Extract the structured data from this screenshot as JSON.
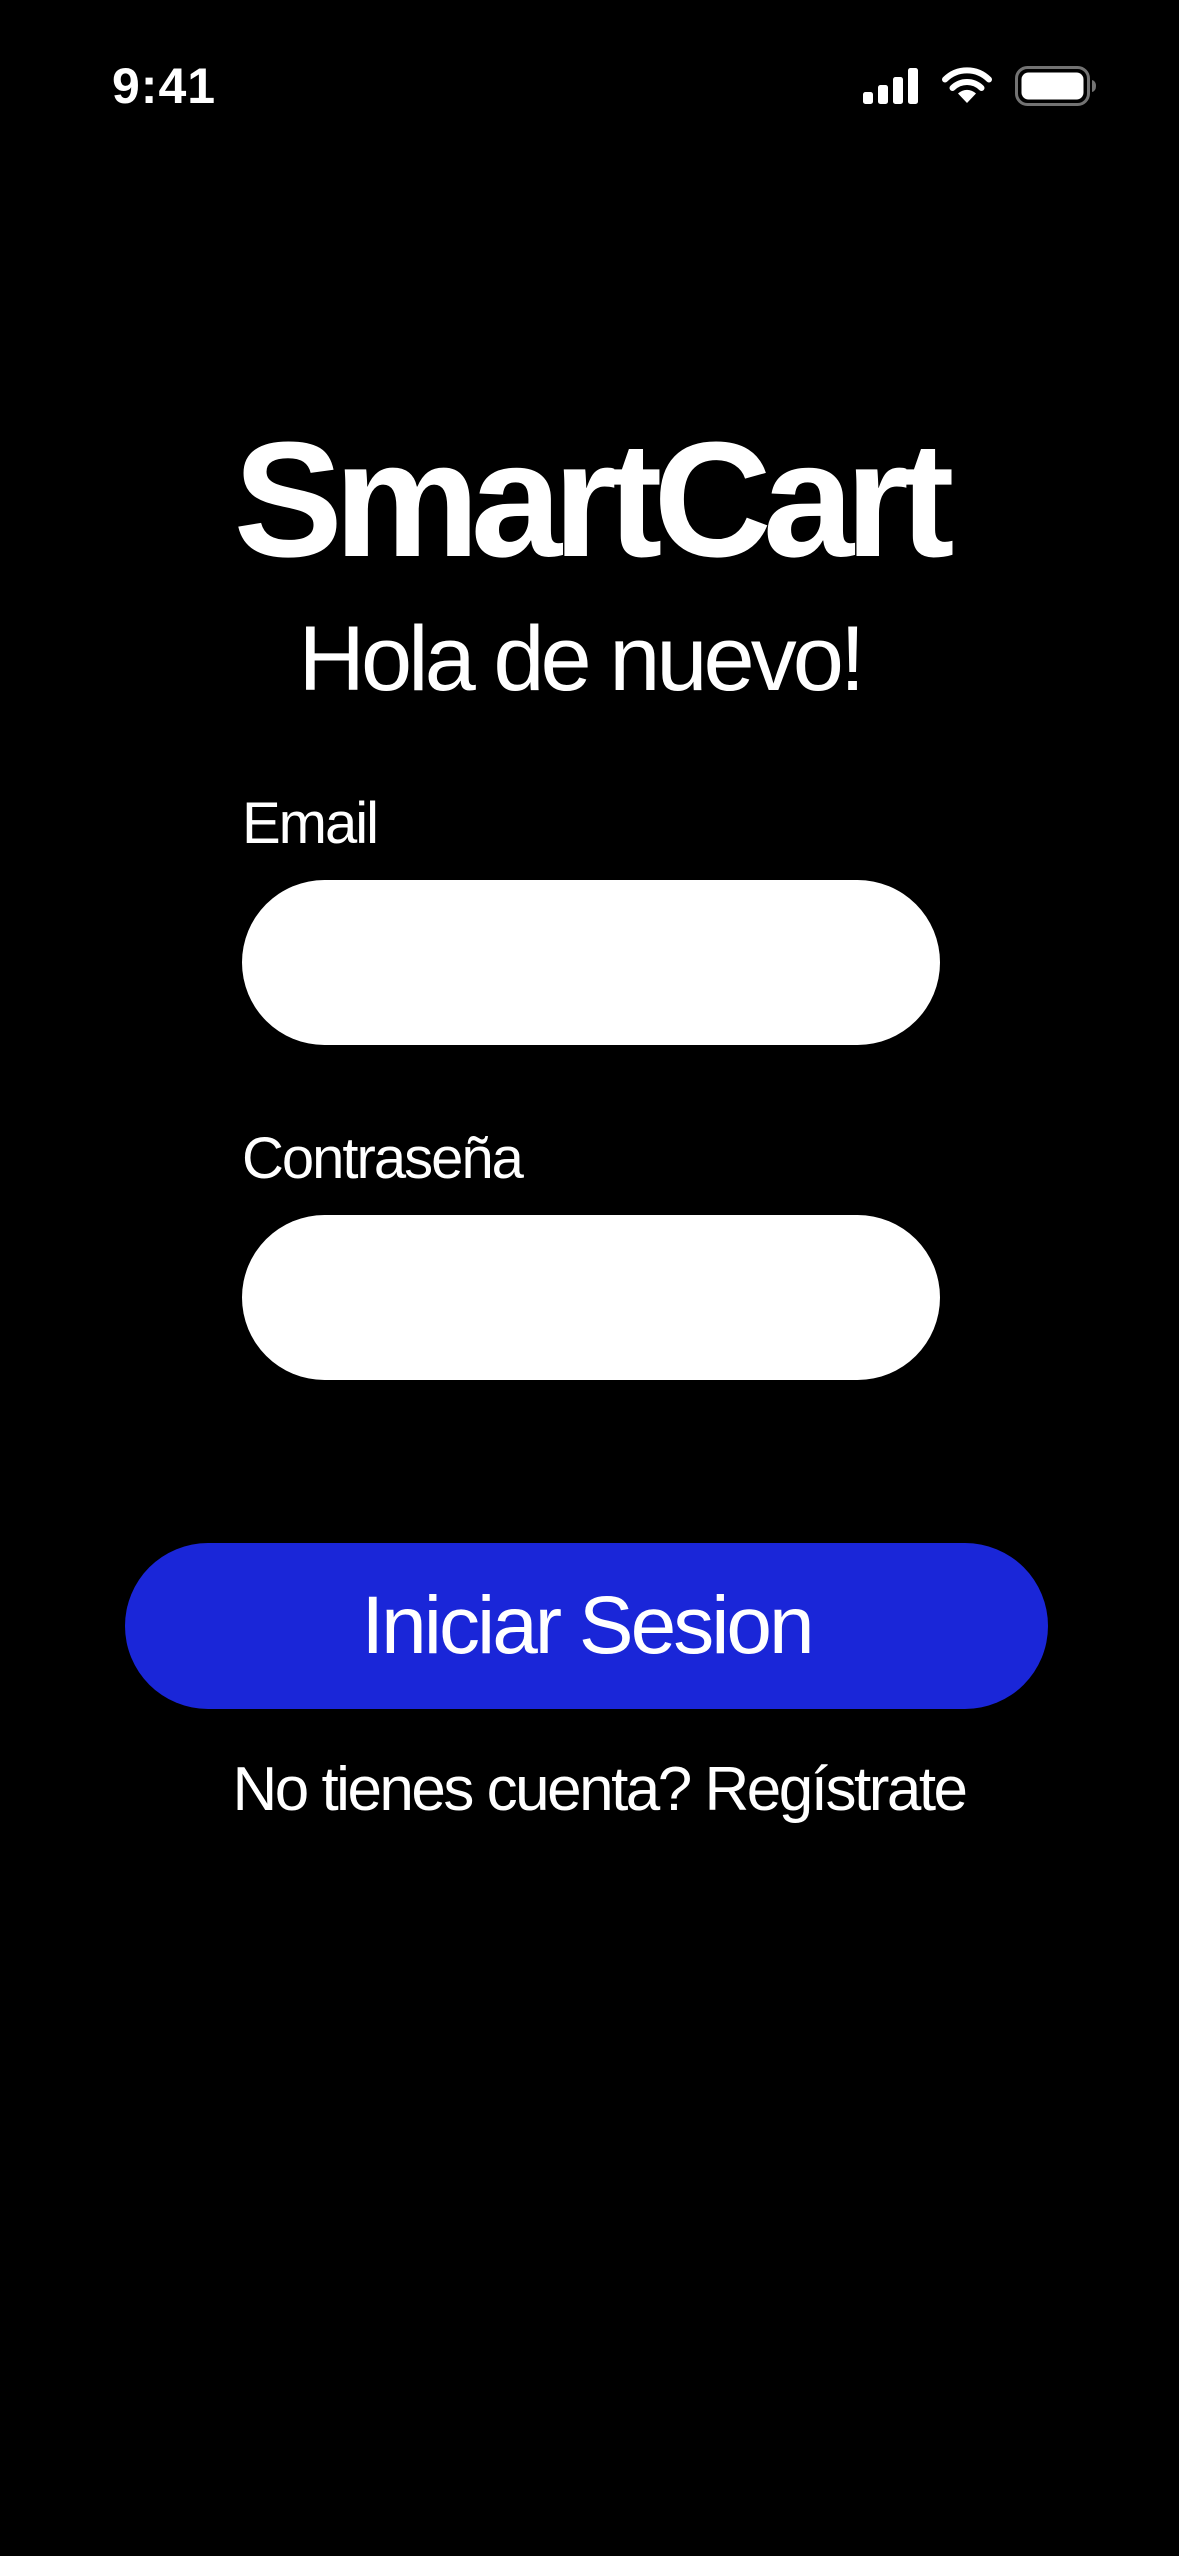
{
  "status_bar": {
    "time": "9:41",
    "icons": [
      "cellular-signal-icon",
      "wifi-icon",
      "battery-icon"
    ]
  },
  "app": {
    "title": "SmartCart",
    "greeting": "Hola de nuevo!"
  },
  "form": {
    "email": {
      "label": "Email",
      "value": "",
      "placeholder": ""
    },
    "password": {
      "label": "Contraseña",
      "value": "",
      "placeholder": ""
    },
    "submit_label": "Iniciar Sesion"
  },
  "signup": {
    "prompt": "No tienes cuenta?",
    "link_label": "Regístrate"
  },
  "colors": {
    "background": "#000000",
    "text": "#ffffff",
    "input_background": "#ffffff",
    "accent": "#1a26d8"
  }
}
